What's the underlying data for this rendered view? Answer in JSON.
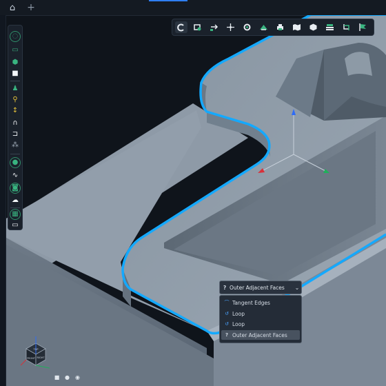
{
  "tabs": {
    "home_icon": "home-icon",
    "add_label": "+"
  },
  "toolbar_top": {
    "tools": [
      {
        "icon": "sketch-c-icon",
        "active": true
      },
      {
        "icon": "rotate-view-icon"
      },
      {
        "icon": "pan-view-icon"
      },
      {
        "icon": "move-icon"
      },
      {
        "icon": "settings-gear-icon"
      },
      {
        "icon": "sketch-on-face-icon"
      },
      {
        "icon": "print-icon"
      },
      {
        "icon": "map-icon"
      },
      {
        "icon": "shape-cube-icon"
      },
      {
        "icon": "layer-stack-icon"
      },
      {
        "icon": "convert-icon"
      },
      {
        "icon": "flag-icon"
      }
    ]
  },
  "toolbar_left": {
    "tools": [
      "select-ring-icon",
      "box-icon",
      "cylinder-icon",
      "cube-icon",
      "push-pull-icon",
      "pin-icon",
      "dimension-icon",
      "magnet-icon",
      "bracket-icon",
      "pattern-icon",
      "circle-ring-icon",
      "spline-icon",
      "hole-icon",
      "cloud-icon",
      "table-icon",
      "chat-icon"
    ]
  },
  "selection_dropdown": {
    "prefix": "?",
    "selected": "Outer Adjacent Faces",
    "options": [
      {
        "label": "Tangent Edges",
        "icon": "tangent-edges-icon"
      },
      {
        "label": "Loop",
        "icon": "loop-icon"
      },
      {
        "label": "Loop",
        "icon": "loop-icon"
      },
      {
        "label": "Outer Adjacent Faces",
        "icon": "question-icon",
        "selected": true
      }
    ]
  },
  "view_cube": {
    "top": "TOP",
    "front": "FRONT",
    "right": "RIGHT"
  },
  "view_buttons": [
    "stop-icon",
    "sphere-icon",
    "shaded-icon"
  ],
  "colors": {
    "background": "#0f141b",
    "part_top": "#8a96a3",
    "highlight": "#14a9ff",
    "axis_x": "#d8313a",
    "axis_y": "#1fb05a",
    "axis_z": "#2f6cf5"
  }
}
